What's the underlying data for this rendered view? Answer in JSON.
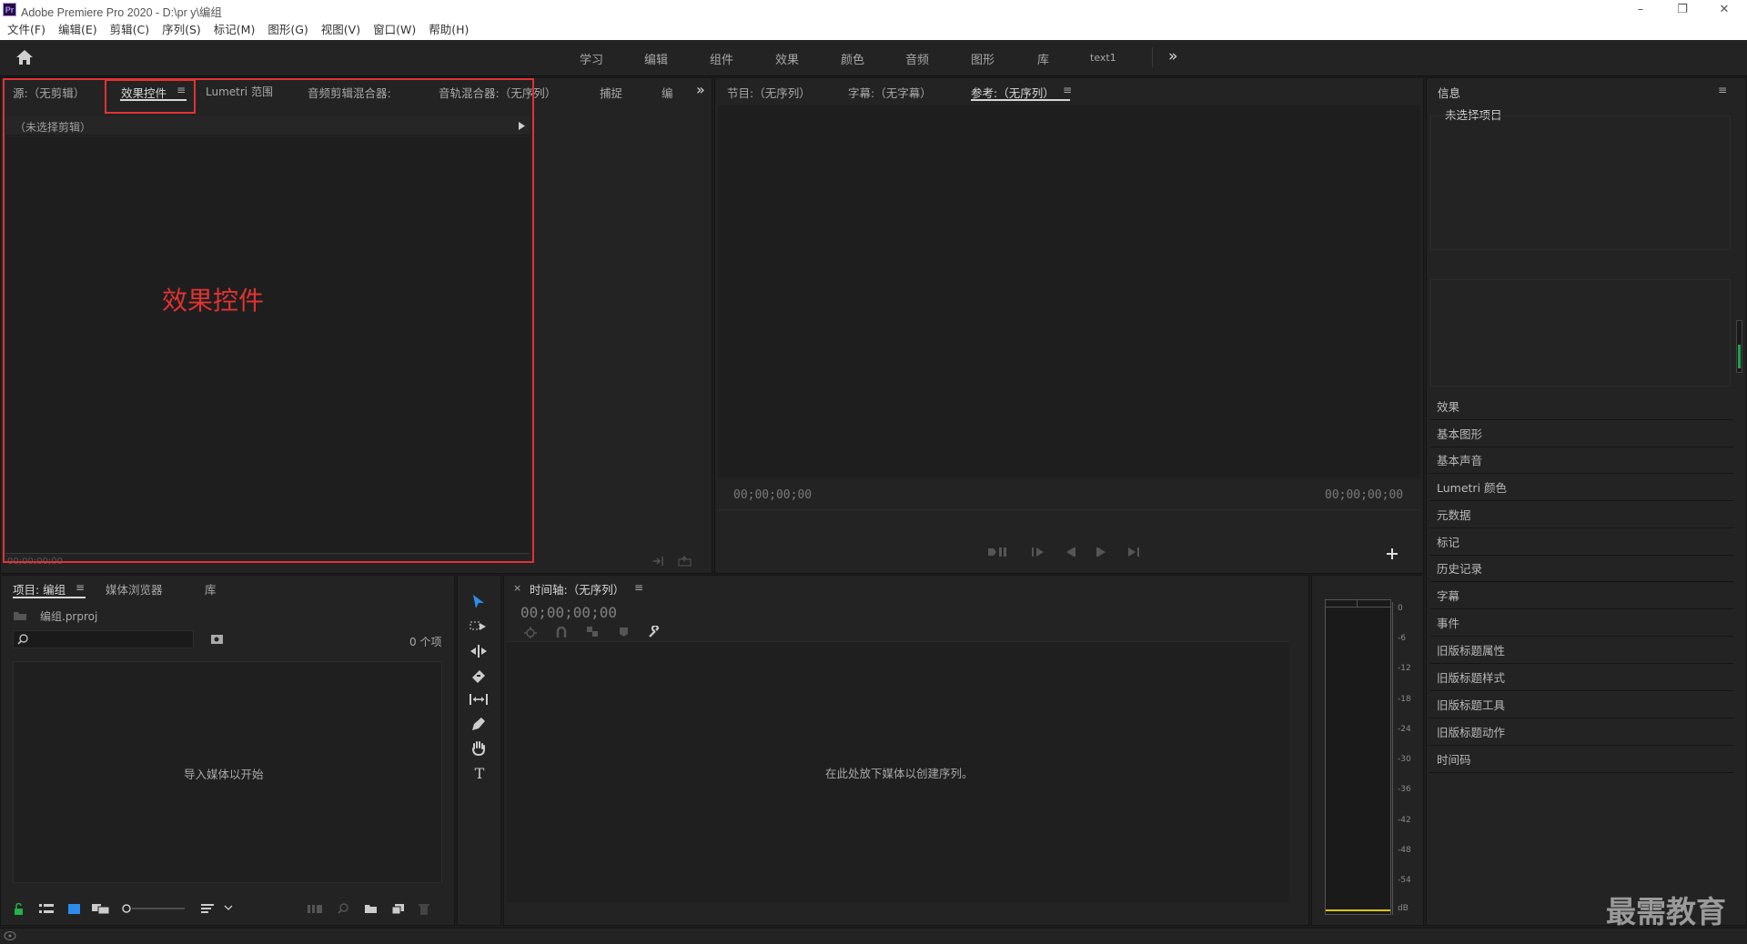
{
  "window": {
    "logo": "Pr",
    "title": "Adobe Premiere Pro 2020 - D:\\pr y\\编组",
    "controls": [
      "–",
      "❐",
      "✕"
    ]
  },
  "menu": [
    "文件(F)",
    "编辑(E)",
    "剪辑(C)",
    "序列(S)",
    "标记(M)",
    "图形(G)",
    "视图(V)",
    "窗口(W)",
    "帮助(H)"
  ],
  "workspaces": [
    "学习",
    "编辑",
    "组件",
    "效果",
    "颜色",
    "音频",
    "图形",
    "库",
    "text1"
  ],
  "overflow_icon": "»",
  "source_panel": {
    "tabs": [
      "源:（无剪辑）",
      "效果控件",
      "Lumetri 范围",
      "音频剪辑混合器:",
      "音轨混合器:（无序列）",
      "捕捉",
      "编"
    ],
    "active_tab": "效果控件",
    "clip_label": "（未选择剪辑）",
    "annotation": "效果控件",
    "timecode": "00;00;00;00"
  },
  "program_panel": {
    "tabs": [
      "节目:（无序列）",
      "字幕:（无字幕）",
      "参考:（无序列）"
    ],
    "active_tab": "参考:（无序列）",
    "timecode_left": "00;00;00;00",
    "timecode_right": "00;00;00;00"
  },
  "info_panel": {
    "title": "信息",
    "empty": "未选择项目",
    "items": [
      "效果",
      "基本图形",
      "基本声音",
      "Lumetri 颜色",
      "元数据",
      "标记",
      "历史记录",
      "字幕",
      "事件",
      "旧版标题属性",
      "旧版标题样式",
      "旧版标题工具",
      "旧版标题动作",
      "时间码"
    ]
  },
  "project_panel": {
    "tabs": [
      "项目: 编组",
      "媒体浏览器",
      "库"
    ],
    "active_tab": "项目: 编组",
    "file": "编组.prproj",
    "count": "0 个项",
    "empty": "导入媒体以开始"
  },
  "timeline_panel": {
    "close": "×",
    "title": "时间轴:（无序列）",
    "timecode": "00;00;00;00",
    "empty": "在此处放下媒体以创建序列。"
  },
  "audio_meter": {
    "labels": [
      "0",
      "-6",
      "-12",
      "-18",
      "-24",
      "-30",
      "-36",
      "-42",
      "-48",
      "-54",
      "dB"
    ]
  },
  "watermark": "最需教育",
  "colors": {
    "highlight": "#e03333",
    "accent": "#2d8ceb",
    "panel_bg": "#232323",
    "app_bg": "#1d1d1d"
  }
}
